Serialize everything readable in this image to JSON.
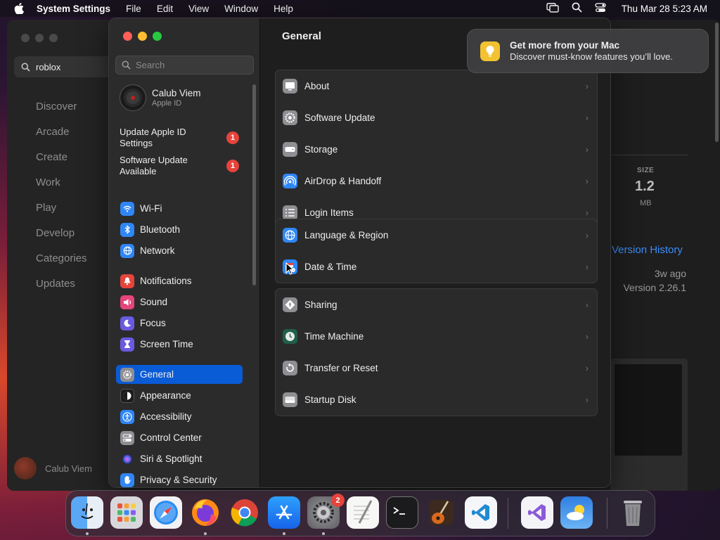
{
  "menubar": {
    "app": "System Settings",
    "menus": [
      "File",
      "Edit",
      "View",
      "Window",
      "Help"
    ],
    "clock": "Thu Mar 28  5:23 AM"
  },
  "appstore": {
    "search_value": "roblox",
    "nav": [
      "Discover",
      "Arcade",
      "Create",
      "Work",
      "Play",
      "Develop",
      "Categories",
      "Updates"
    ],
    "user": "Calub Viem",
    "size_label": "SIZE",
    "size_value": "1.2",
    "size_unit": "MB",
    "version_history": "Version History",
    "updated_ago": "3w ago",
    "version": "Version 2.26.1"
  },
  "settings": {
    "search_placeholder": "Search",
    "account": {
      "name": "Calub Viem",
      "subtitle": "Apple ID"
    },
    "notices": [
      {
        "label": "Update Apple ID Settings",
        "line1": "Update Apple ID",
        "line2": "Settings",
        "count": "1"
      },
      {
        "label": "Software Update Available",
        "line1": "Software Update",
        "line2": "Available",
        "count": "1"
      }
    ],
    "sidebar": [
      {
        "label": "Wi-Fi",
        "icon": "wifi-icon",
        "color": "#2f86f6"
      },
      {
        "label": "Bluetooth",
        "icon": "bluetooth-icon",
        "color": "#2f86f6"
      },
      {
        "label": "Network",
        "icon": "globe-icon",
        "color": "#2f86f6"
      },
      {
        "label": "Notifications",
        "icon": "bell-icon",
        "color": "#e5443b"
      },
      {
        "label": "Sound",
        "icon": "speaker-icon",
        "color": "#e5447c"
      },
      {
        "label": "Focus",
        "icon": "moon-icon",
        "color": "#6a5ae0"
      },
      {
        "label": "Screen Time",
        "icon": "hourglass-icon",
        "color": "#6a5ae0"
      },
      {
        "label": "General",
        "icon": "gear-icon",
        "color": "#8e8e93",
        "selected": true
      },
      {
        "label": "Appearance",
        "icon": "appearance-icon",
        "color": "#1c1c1e"
      },
      {
        "label": "Accessibility",
        "icon": "accessibility-icon",
        "color": "#2f86f6"
      },
      {
        "label": "Control Center",
        "icon": "toggles-icon",
        "color": "#8e8e93"
      },
      {
        "label": "Siri & Spotlight",
        "icon": "siri-icon",
        "color": "#9b4fd6"
      },
      {
        "label": "Privacy & Security",
        "icon": "hand-icon",
        "color": "#2f86f6"
      }
    ],
    "title": "General",
    "groups": [
      [
        {
          "label": "About",
          "icon": "display-icon"
        },
        {
          "label": "Software Update",
          "icon": "gear-badge-icon"
        },
        {
          "label": "Storage",
          "icon": "drive-icon"
        },
        {
          "label": "AirDrop & Handoff",
          "icon": "airdrop-icon"
        },
        {
          "label": "Login Items",
          "icon": "list-icon"
        }
      ],
      [
        {
          "label": "Language & Region",
          "icon": "globe-icon"
        },
        {
          "label": "Date & Time",
          "icon": "calendar-clock-icon"
        }
      ],
      [
        {
          "label": "Sharing",
          "icon": "sharing-icon"
        },
        {
          "label": "Time Machine",
          "icon": "time-machine-icon"
        },
        {
          "label": "Transfer or Reset",
          "icon": "reset-icon"
        },
        {
          "label": "Startup Disk",
          "icon": "disk-icon"
        }
      ]
    ]
  },
  "tip": {
    "title": "Get more from your Mac",
    "body": "Discover must-know features you’ll love."
  },
  "dock": {
    "apps": [
      "Finder",
      "Launchpad",
      "Safari",
      "Firefox",
      "Chrome",
      "App Store",
      "System Settings",
      "TextEdit",
      "Terminal",
      "GarageBand",
      "Visual Studio Code",
      "Visual Studio",
      "Weather",
      "Trash"
    ],
    "settings_badge": "2"
  }
}
